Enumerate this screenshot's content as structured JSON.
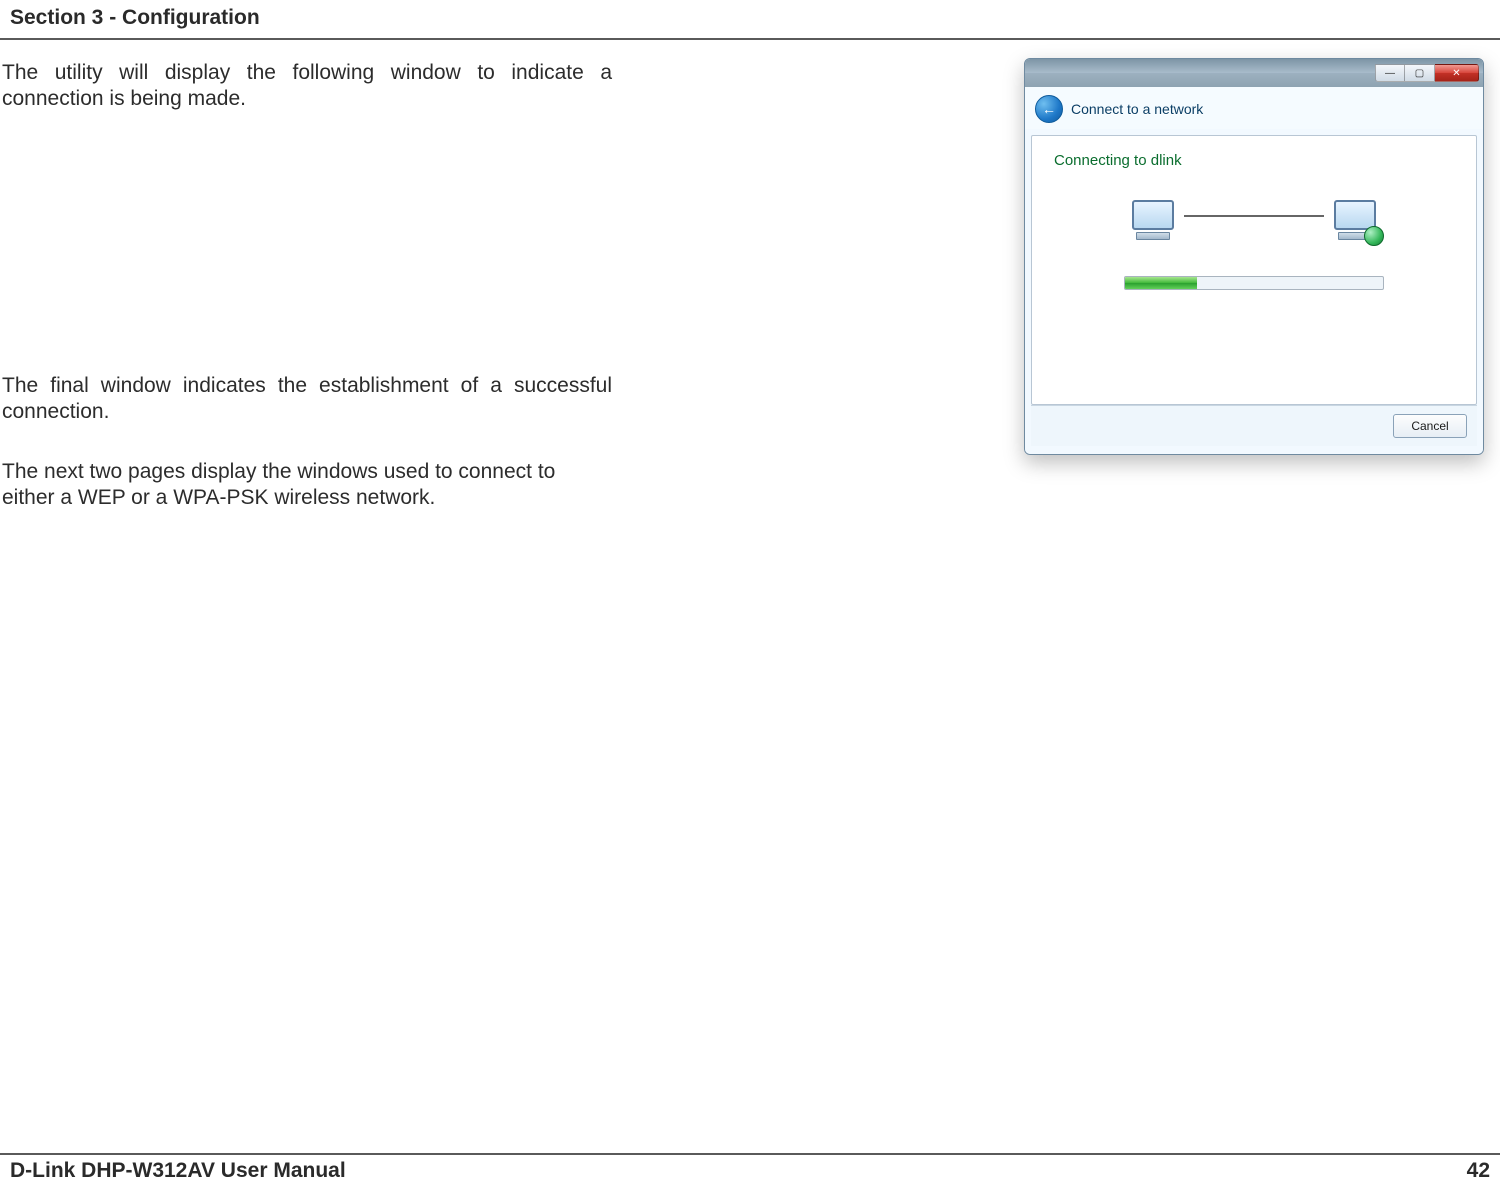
{
  "header": {
    "section": "Section 3 - Configuration"
  },
  "body": {
    "p1": "The utility will display the following window to indicate a connection is being made.",
    "p2": "The final window indicates the establishment of a successful connection.",
    "p3": "The next two pages display the windows used to connect to either a WEP or a WPA-PSK wireless network."
  },
  "dialog": {
    "title": "Connect to a network",
    "connecting_label": "Connecting to dlink",
    "cancel_label": "Cancel",
    "close_glyph": "✕",
    "max_glyph": "▢",
    "min_glyph": "—",
    "back_glyph": "←"
  },
  "footer": {
    "manual": "D-Link DHP-W312AV User Manual",
    "page": "42"
  }
}
